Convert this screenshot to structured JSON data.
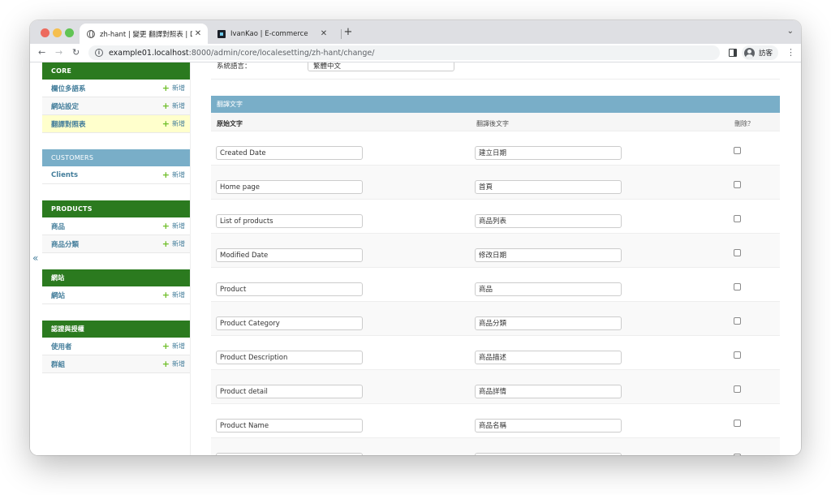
{
  "browser": {
    "tabs": [
      {
        "title": "zh-hant | 變更 翻譯對照表 | Djan",
        "active": true,
        "favicon": "globe-icon"
      },
      {
        "title": "IvanKao | E-commerce",
        "active": false,
        "favicon": "app-icon"
      }
    ],
    "url_host": "example01.localhost",
    "url_path": ":8000/admin/core/localesetting/zh-hant/change/",
    "profile_label": "訪客"
  },
  "sidebar": {
    "collapse_glyph": "«",
    "add_label": "新增",
    "modules": [
      {
        "caption": "CORE",
        "style": "green",
        "items": [
          {
            "label": "欄位多語系",
            "current": false
          },
          {
            "label": "網站設定",
            "current": false
          },
          {
            "label": "翻譯對照表",
            "current": true
          }
        ]
      },
      {
        "caption": "CUSTOMERS",
        "style": "blue",
        "items": [
          {
            "label": "Clients",
            "current": false
          }
        ]
      },
      {
        "caption": "PRODUCTS",
        "style": "green",
        "items": [
          {
            "label": "商品",
            "current": false
          },
          {
            "label": "商品分類",
            "current": false
          }
        ]
      },
      {
        "caption": "網站",
        "style": "green",
        "items": [
          {
            "label": "網站",
            "current": false
          }
        ]
      },
      {
        "caption": "認證與授權",
        "style": "green",
        "items": [
          {
            "label": "使用者",
            "current": false
          },
          {
            "label": "群組",
            "current": false
          }
        ]
      }
    ]
  },
  "form": {
    "language_label": "系統語言：",
    "language_value": "繁體中文",
    "inline_caption": "翻譯文字",
    "col_original": "原始文字",
    "col_translated": "翻譯後文字",
    "col_delete": "刪除？",
    "rows": [
      {
        "original": "Created Date",
        "translated": "建立日期"
      },
      {
        "original": "Home page",
        "translated": "首頁"
      },
      {
        "original": "List of products",
        "translated": "商品列表"
      },
      {
        "original": "Modified Date",
        "translated": "修改日期"
      },
      {
        "original": "Product",
        "translated": "商品"
      },
      {
        "original": "Product Category",
        "translated": "商品分類"
      },
      {
        "original": "Product Description",
        "translated": "商品描述"
      },
      {
        "original": "Product detail",
        "translated": "商品詳情"
      },
      {
        "original": "Product Name",
        "translated": "商品名稱"
      },
      {
        "original": "",
        "translated": ""
      }
    ]
  }
}
